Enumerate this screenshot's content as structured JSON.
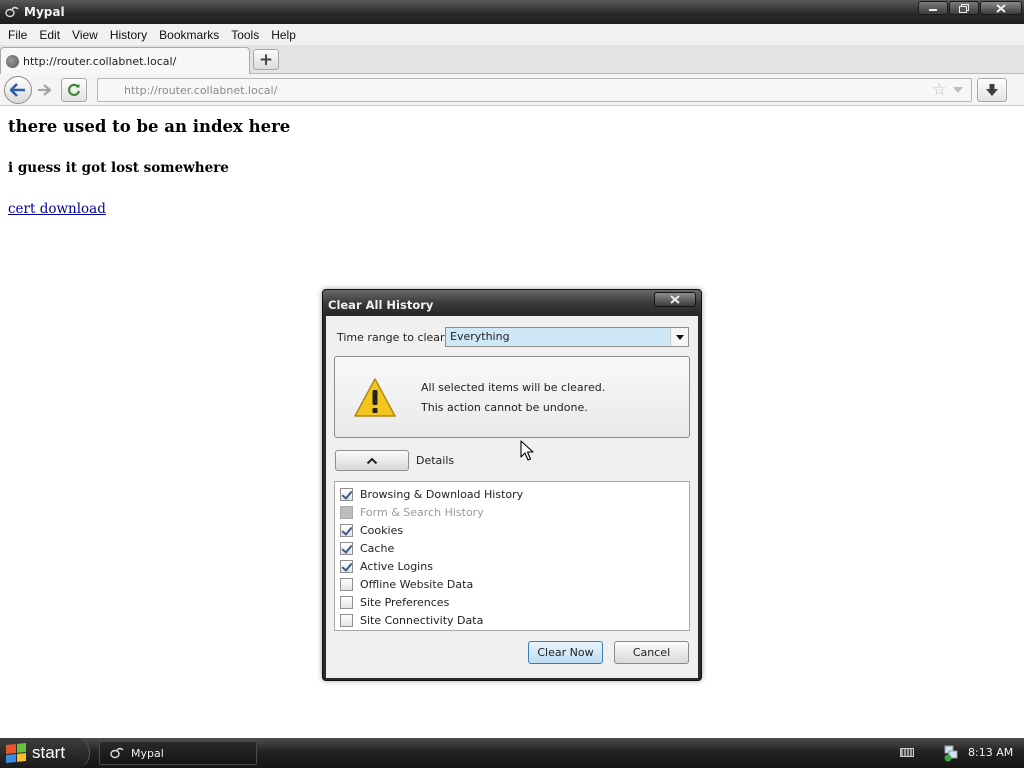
{
  "window": {
    "title": "Mypal"
  },
  "menubar": {
    "items": [
      {
        "label": "File"
      },
      {
        "label": "Edit"
      },
      {
        "label": "View"
      },
      {
        "label": "History"
      },
      {
        "label": "Bookmarks"
      },
      {
        "label": "Tools"
      },
      {
        "label": "Help"
      }
    ]
  },
  "tabs": [
    {
      "label": "http://router.collabnet.local/"
    }
  ],
  "newtab": {
    "label": "+"
  },
  "urlbar": {
    "value": "http://router.collabnet.local/"
  },
  "page": {
    "heading": "there used to be an index here",
    "subheading": "i guess it got lost somewhere",
    "link": "cert download"
  },
  "dialog": {
    "title": "Clear All History",
    "time_range_label": "Time range to clear:",
    "time_range_value": "Everything",
    "warning_line1": "All selected items will be cleared.",
    "warning_line2": "This action cannot be undone.",
    "details_label": "Details",
    "items": [
      {
        "label": "Browsing & Download History",
        "checked": true,
        "disabled": false
      },
      {
        "label": "Form & Search History",
        "checked": false,
        "disabled": true
      },
      {
        "label": "Cookies",
        "checked": true,
        "disabled": false
      },
      {
        "label": "Cache",
        "checked": true,
        "disabled": false
      },
      {
        "label": "Active Logins",
        "checked": true,
        "disabled": false
      },
      {
        "label": "Offline Website Data",
        "checked": false,
        "disabled": false
      },
      {
        "label": "Site Preferences",
        "checked": false,
        "disabled": false
      },
      {
        "label": "Site Connectivity Data",
        "checked": false,
        "disabled": false
      }
    ],
    "clear_button": "Clear Now",
    "cancel_button": "Cancel"
  },
  "taskbar": {
    "start_label": "start",
    "task_label": "Mypal",
    "clock": "8:13 AM"
  },
  "colors": {
    "link": "#00009c",
    "select_highlight": "#cfe8f7",
    "primary_button_border": "#3e7cb3"
  }
}
